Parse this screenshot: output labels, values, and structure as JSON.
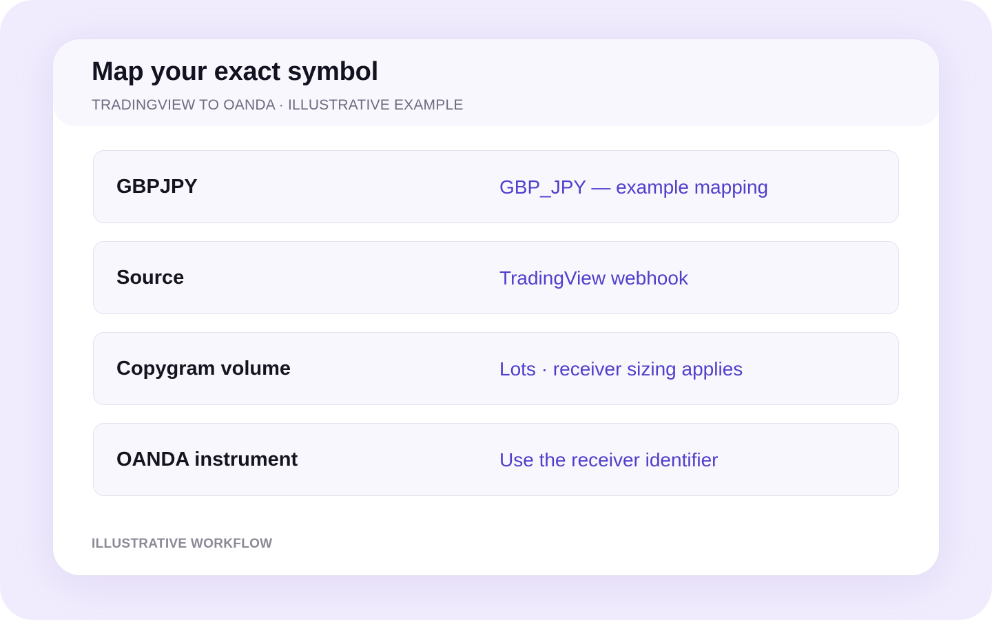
{
  "card": {
    "title": "Map your exact symbol",
    "subtitle": "TRADINGVIEW TO OANDA · ILLUSTRATIVE EXAMPLE",
    "rows": [
      {
        "label": "GBPJPY",
        "value": "GBP_JPY — example mapping"
      },
      {
        "label": "Source",
        "value": "TradingView webhook"
      },
      {
        "label": "Copygram volume",
        "value": "Lots · receiver sizing applies"
      },
      {
        "label": "OANDA instrument",
        "value": "Use the receiver identifier"
      }
    ],
    "footer": "ILLUSTRATIVE WORKFLOW"
  },
  "colors": {
    "background": "#f1ecfd",
    "card": "#ffffff",
    "header": "#f8f7fd",
    "accent": "#4f3fca",
    "label": "#14141f",
    "muted": "#6c6c80"
  }
}
